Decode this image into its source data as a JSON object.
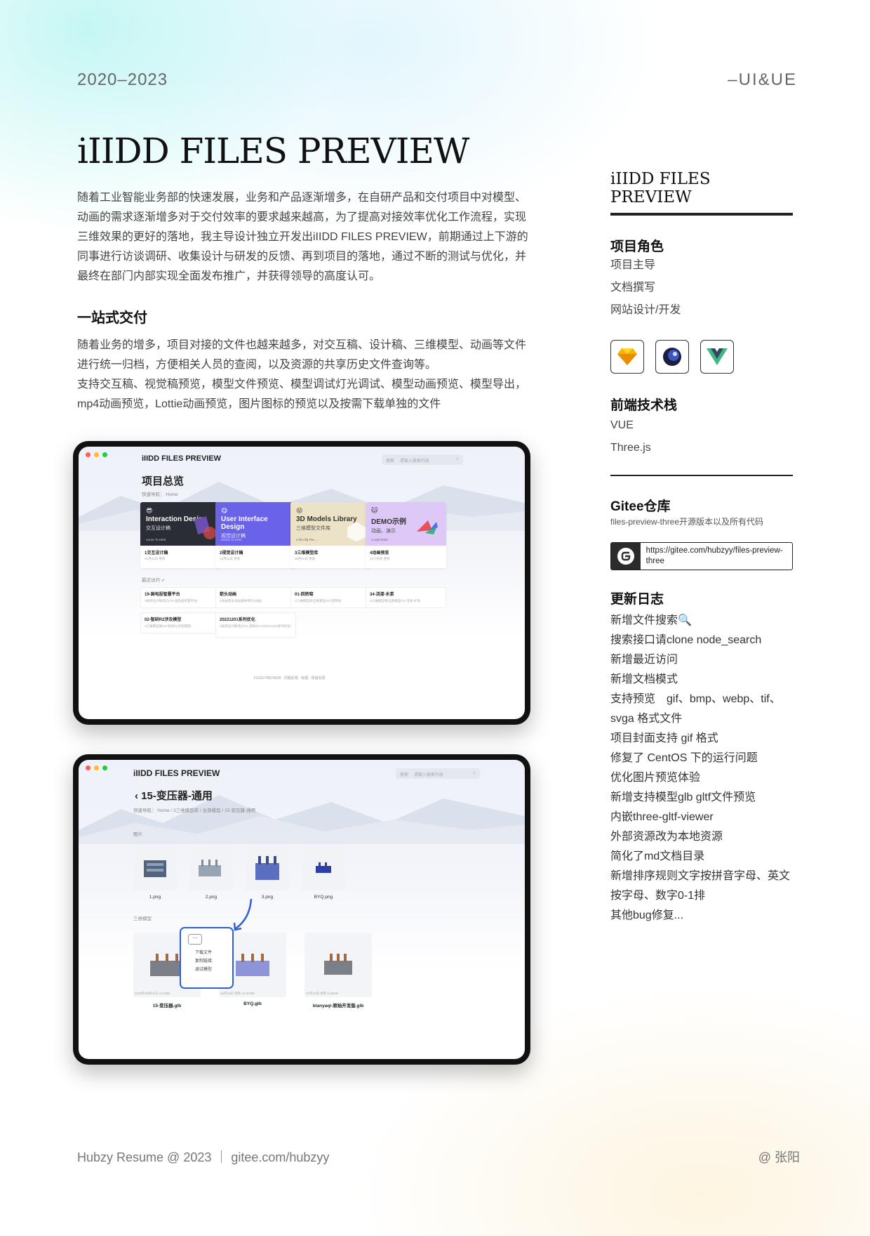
{
  "header": {
    "year": "2020–2023",
    "role_tag": "–UI&UE"
  },
  "title": "iIIDD FILES PREVIEW",
  "intro": "随着工业智能业务部的快速发展，业务和产品逐渐增多，在自研产品和交付项目中对模型、动画的需求逐渐增多对于交付效率的要求越来越高，为了提高对接效率优化工作流程，实现三维效果的更好的落地，我主导设计独立开发出iIIDD FILES PREVIEW，前期通过上下游的同事进行访谈调研、收集设计与研发的反馈、再到项目的落地，通过不断的测试与优化，并最终在部门内部实现全面发布推广，并获得领导的高度认可。",
  "section": {
    "heading": "一站式交付",
    "para1": "随着业务的增多，项目对接的文件也越来越多，对交互稿、设计稿、三维模型、动画等文件进行统一归档，方便相关人员的查阅，以及资源的共享历史文件查询等。",
    "para2": "支持交互稿、视觉稿预览，模型文件预览、模型调试灯光调试、模型动画预览、模型导出，mp4动画预览，Lottie动画预览，图片图标的预览以及按需下载单独的文件"
  },
  "screen1": {
    "app_title": "iIIDD FILES PREVIEW",
    "search_tab": "搜索",
    "search_placeholder": "请输入搜索内容",
    "page_title": "项目总览",
    "breadcrumb": "快速导航： Home",
    "cards": [
      {
        "title": "Interaction Design",
        "sub": "交互设计稿",
        "tag": "Axure To Html",
        "name": "1交互设计稿",
        "meta": "01月02日 更新",
        "color": "#2a2d35",
        "emoji": "😎"
      },
      {
        "title": "User Interface Design",
        "sub": "视觉设计稿",
        "tag": "sketch To Html",
        "name": "2视觉设计稿",
        "meta": "10月01日 更新",
        "color": "#6a62e8",
        "emoji": "😋"
      },
      {
        "title": "3D Models Library",
        "sub": "三维模型文件库",
        "tag": "C4D Obj Fbx ...",
        "name": "3三维模型库",
        "meta": "08月15日 更新",
        "color": "#ebe2c8",
        "emoji": "😜"
      },
      {
        "title": "DEMO示例",
        "sub": "动画、演示",
        "tag": "1 April 2022",
        "name": "4动画预览",
        "meta": "10小时前 更新",
        "color": "#ddc8f7",
        "emoji": "🐱"
      }
    ],
    "recent_label": "最近访问",
    "recent": [
      {
        "name": "19-国电投智慧平台",
        "path": "2视觉设计稿/电力/19-国电投智慧平台/"
      },
      {
        "name": "箭头动画",
        "path": "4动画预览/动画素材/箭头动画/"
      },
      {
        "name": "01-回转窑",
        "path": "3三维模型库/全部模型/01-回转窑/"
      },
      {
        "name": "34-浇漆-水泵",
        "path": "3三维模型库/全部模型/34-浇漆-水泵/"
      },
      {
        "name": "02-智研R2涉及模型",
        "path": "3三维模型库/02-智研R2涉及模型/"
      },
      {
        "name": "20221201系列优化",
        "path": "2视觉设计稿/电力/11-智研R2.1/20221201系列优化/"
      }
    ],
    "footer": "FILES PREVIEW · 问题反馈 · 标题 · 体验反馈"
  },
  "screen2": {
    "app_title": "iIIDD FILES PREVIEW",
    "search_tab": "搜索",
    "search_placeholder": "请输入搜索内容",
    "page_title": "15-变压器-通用",
    "breadcrumb": "快速导航： Home / 3三维模型库 / 全部模型 / 15-变压器-通用",
    "images_label": "图片",
    "images": [
      "1.png",
      "2.png",
      "3.png",
      "BYQ.png"
    ],
    "models_label": "三维模型",
    "models": [
      {
        "name": "15-变压器.glb",
        "meta": "2020年08月01日 22:4MB"
      },
      {
        "name": "BYQ.glb",
        "meta": "04月19日 更新 15.87MB"
      },
      {
        "name": "bianyaqi-原始开发版.glb",
        "meta": "03月15日 更新 5.86MB"
      }
    ],
    "menu": {
      "dots": "···",
      "items": [
        "下载文件",
        "复制链接",
        "调试模型"
      ]
    }
  },
  "sidebar": {
    "title": "iIIDD FILES PREVIEW",
    "role_heading": "项目角色",
    "roles": [
      "项目主导",
      "文档撰写",
      "网站设计/开发"
    ],
    "tech_heading": "前端技术栈",
    "tech": [
      "VUE",
      "Three.js"
    ],
    "gitee_heading": "Gitee仓库",
    "gitee_desc": "files-preview-three开源版本以及所有代码",
    "gitee_url": "https://gitee.com/hubzyy/files-preview-three",
    "log_heading": "更新日志",
    "log": [
      "新增文件搜索🔍",
      "搜索接口请clone node_search",
      "新增最近访问",
      "新增文档模式",
      "支持预览　gif、bmp、webp、tif、svga 格式文件",
      "项目封面支持 gif 格式",
      "修复了 CentOS 下的运行问题",
      "优化图片预览体验",
      "新增支持模型glb gltf文件预览",
      "内嵌three-gltf-viewer",
      "外部资源改为本地资源",
      "简化了md文档目录",
      "新增排序规则文字按拼音字母、英文按字母、数字0-1排",
      "其他bug修复..."
    ]
  },
  "footer": {
    "left": "Hubzy Resume @ 2023 ｜ gitee.com/hubzyy",
    "right": "@ 张阳"
  },
  "colors": {
    "accent_blue": "#2e5ed8",
    "text_dark": "#111111"
  }
}
